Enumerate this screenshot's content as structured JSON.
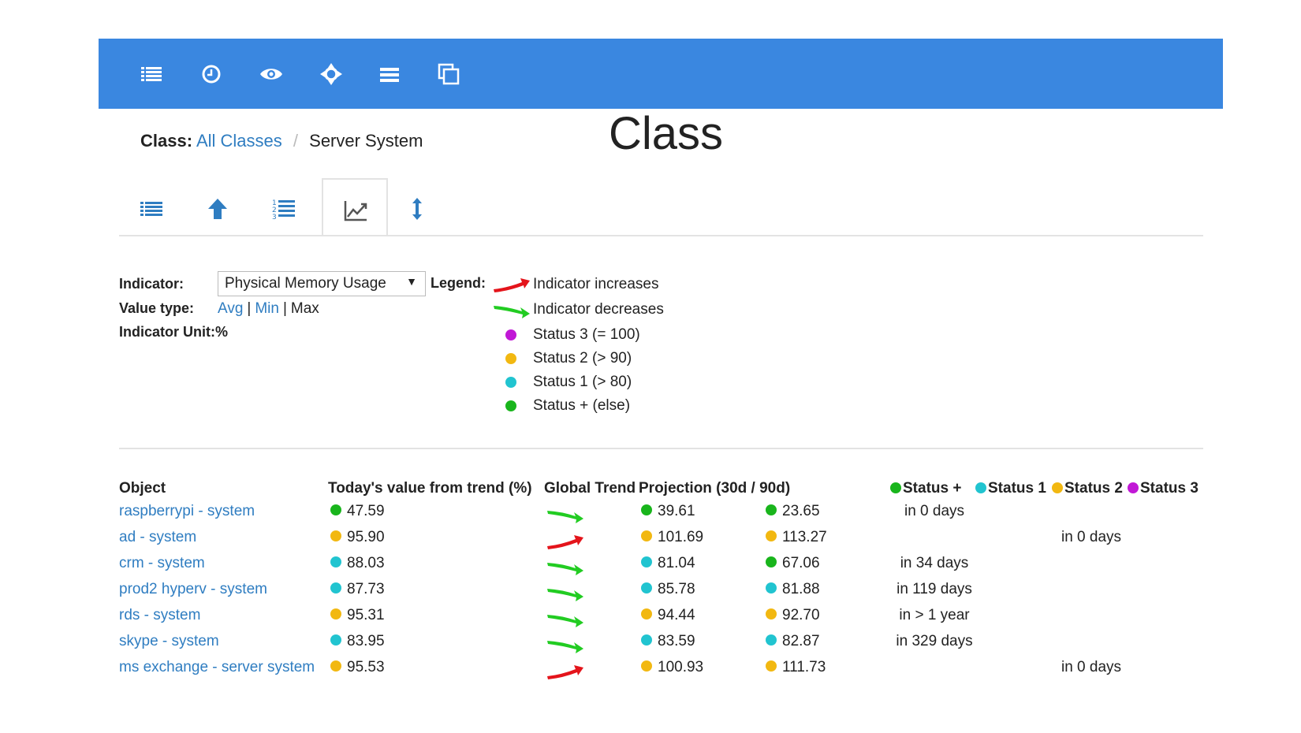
{
  "colors": {
    "topbar": "#3a87e0",
    "link": "#2f7dc1",
    "status_plus": "#19b51c",
    "status_1": "#21c4d0",
    "status_2": "#f2b811",
    "status_3": "#c118d6",
    "arrow_up": "#e4141b",
    "arrow_down": "#22cc22"
  },
  "toolbar": {
    "icons": [
      "list-icon",
      "clock-icon",
      "eye-icon",
      "crosshair-icon",
      "menu-icon",
      "copy-icon"
    ]
  },
  "breadcrumb": {
    "label": "Class:",
    "link": "All Classes",
    "separator": "/",
    "current": "Server System"
  },
  "page_title": "Class",
  "tabs": {
    "icons": [
      "list-icon",
      "arrow-up-icon",
      "numbered-list-icon",
      "line-chart-icon",
      "vertical-resize-icon"
    ],
    "active_index": 3
  },
  "controls": {
    "indicator_label": "Indicator:",
    "indicator_value": "Physical Memory Usage",
    "value_type_label": "Value type:",
    "value_type_options": [
      "Avg",
      "Min",
      "Max"
    ],
    "value_type_selected": "Max",
    "unit_label": "Indicator Unit:%"
  },
  "legend": {
    "label": "Legend:",
    "increases": "Indicator increases",
    "decreases": "Indicator decreases",
    "status_3": "Status 3 (= 100)",
    "status_2": "Status 2 (> 90)",
    "status_1": "Status 1 (> 80)",
    "status_plus": "Status + (else)"
  },
  "table": {
    "headers": {
      "object": "Object",
      "today": "Today's value from trend (%)",
      "trend": "Global Trend",
      "projection": "Projection (30d / 90d)",
      "status_plus": "Status +",
      "status_1": "Status 1",
      "status_2": "Status 2",
      "status_3": "Status 3"
    },
    "rows": [
      {
        "object": "raspberrypi - system",
        "today": "47.59",
        "today_status": "plus",
        "trend": "down",
        "p30": "39.61",
        "p30_status": "plus",
        "p90": "23.65",
        "p90_status": "plus",
        "status_plus": "in 0 days",
        "status_1": "",
        "status_2": "",
        "status_3": ""
      },
      {
        "object": "ad - system",
        "today": "95.90",
        "today_status": "2",
        "trend": "up",
        "p30": "101.69",
        "p30_status": "2",
        "p90": "113.27",
        "p90_status": "2",
        "status_plus": "",
        "status_1": "",
        "status_2": "in 0 days",
        "status_3": ""
      },
      {
        "object": "crm - system",
        "today": "88.03",
        "today_status": "1",
        "trend": "down",
        "p30": "81.04",
        "p30_status": "1",
        "p90": "67.06",
        "p90_status": "plus",
        "status_plus": "in 34 days",
        "status_1": "",
        "status_2": "",
        "status_3": ""
      },
      {
        "object": "prod2 hyperv - system",
        "today": "87.73",
        "today_status": "1",
        "trend": "down",
        "p30": "85.78",
        "p30_status": "1",
        "p90": "81.88",
        "p90_status": "1",
        "status_plus": "in 119 days",
        "status_1": "",
        "status_2": "",
        "status_3": ""
      },
      {
        "object": "rds - system",
        "today": "95.31",
        "today_status": "2",
        "trend": "down",
        "p30": "94.44",
        "p30_status": "2",
        "p90": "92.70",
        "p90_status": "2",
        "status_plus": "in > 1 year",
        "status_1": "",
        "status_2": "",
        "status_3": ""
      },
      {
        "object": "skype - system",
        "today": "83.95",
        "today_status": "1",
        "trend": "down",
        "p30": "83.59",
        "p30_status": "1",
        "p90": "82.87",
        "p90_status": "1",
        "status_plus": "in 329 days",
        "status_1": "",
        "status_2": "",
        "status_3": ""
      },
      {
        "object": "ms exchange - server system",
        "today": "95.53",
        "today_status": "2",
        "trend": "up",
        "p30": "100.93",
        "p30_status": "2",
        "p90": "111.73",
        "p90_status": "2",
        "status_plus": "",
        "status_1": "",
        "status_2": "in 0 days",
        "status_3": ""
      }
    ]
  }
}
